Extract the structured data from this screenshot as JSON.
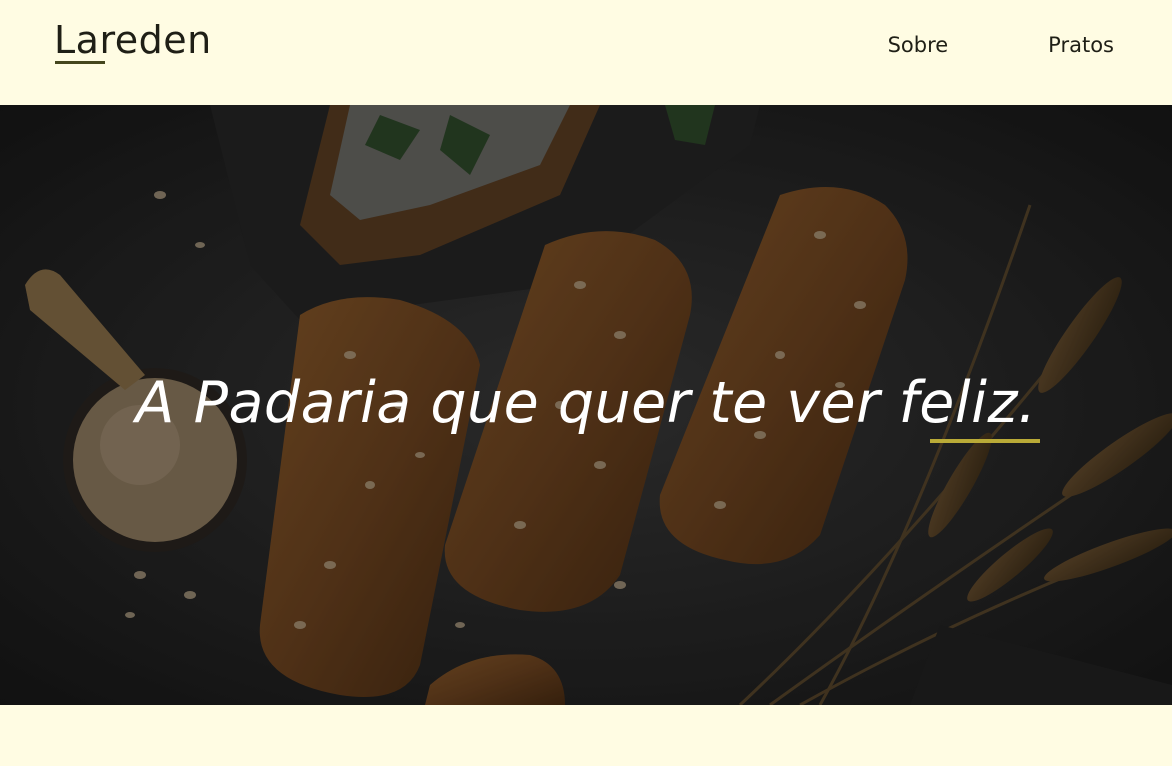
{
  "brand": {
    "logo_text": "Lareden"
  },
  "nav": {
    "items": [
      "Sobre",
      "Pratos"
    ]
  },
  "hero": {
    "title": "A Padaria que quer te ver feliz.",
    "image_subject": "bread-with-oats-and-wheat"
  },
  "colors": {
    "background": "#FFFCE3",
    "text": "#1F1F16",
    "logo_underline": "#45461D",
    "accent": "#B9AA37"
  }
}
